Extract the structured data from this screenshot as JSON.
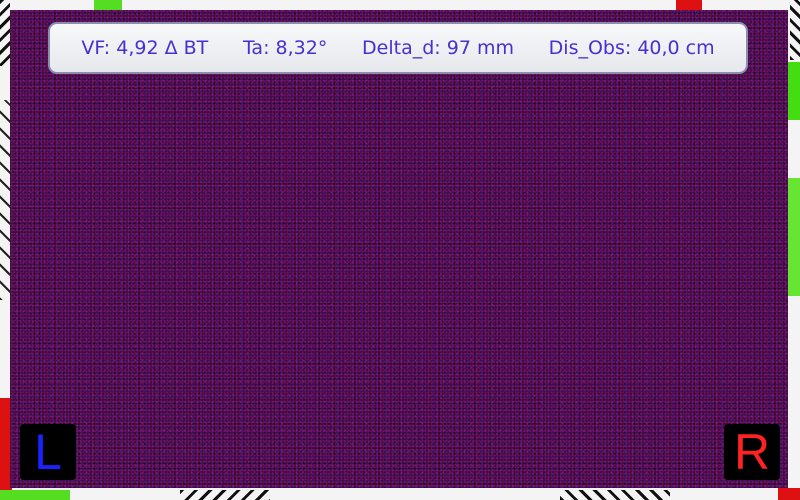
{
  "hud": {
    "vf": "VF: 4,92 Δ BT",
    "ta": "Ta: 8,32°",
    "delta_d": "Delta_d: 97 mm",
    "dis_obs": "Dis_Obs: 40,0 cm"
  },
  "buttons": {
    "left_label": "L",
    "right_label": "R"
  },
  "colors": {
    "hud_text": "#4a2fd0",
    "left_button_text": "#1a22ff",
    "right_button_text": "#ff2222",
    "stage_base": "#3a0d4a"
  }
}
